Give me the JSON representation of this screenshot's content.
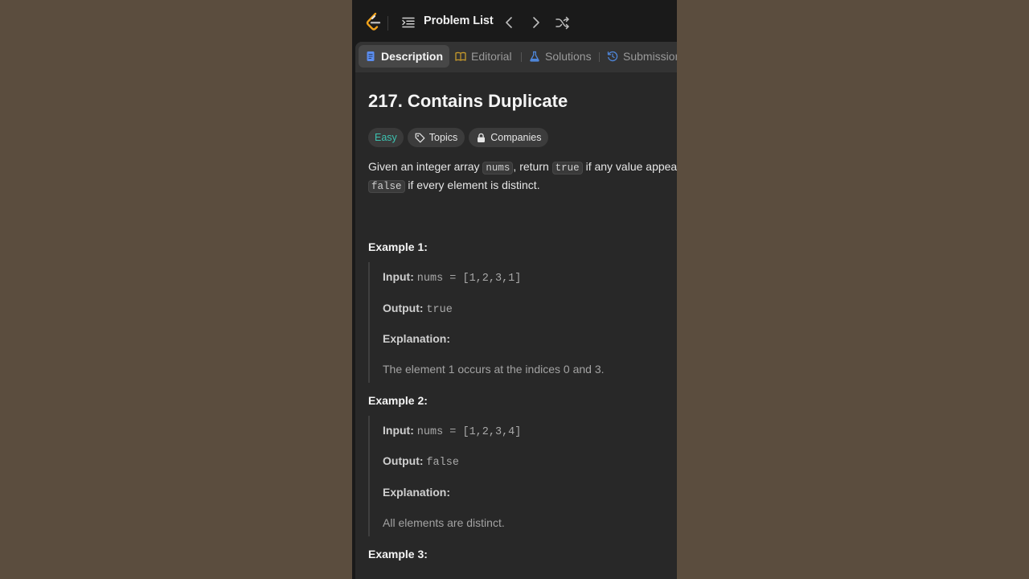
{
  "topbar": {
    "problem_list_label": "Problem List",
    "icons": [
      "leetcode-logo-icon",
      "list-icon",
      "chevron-left-icon",
      "chevron-right-icon",
      "shuffle-icon"
    ]
  },
  "tabs": [
    {
      "label": "Description",
      "icon": "description-icon",
      "active": true
    },
    {
      "label": "Editorial",
      "icon": "book-icon",
      "active": false
    },
    {
      "label": "Solutions",
      "icon": "flask-icon",
      "active": false
    },
    {
      "label": "Submissions",
      "icon": "history-icon",
      "active": false
    }
  ],
  "problem": {
    "title": "217. Contains Duplicate",
    "difficulty": "Easy",
    "topics_label": "Topics",
    "companies_label": "Companies",
    "desc_part1": "Given an integer array ",
    "desc_code1": "nums",
    "desc_part2": ", return ",
    "desc_code2": "true",
    "desc_part3": " if any value appears at least twice in the array, and return",
    "desc_code3": "false",
    "desc_part4": " if every element is distinct."
  },
  "examples": [
    {
      "title": "Example 1:",
      "input_label": "Input:",
      "input": "nums = [1,2,3,1]",
      "output_label": "Output:",
      "output": "true",
      "explanation_label": "Explanation:",
      "explanation": "The element 1 occurs at the indices 0 and 3."
    },
    {
      "title": "Example 2:",
      "input_label": "Input:",
      "input": "nums = [1,2,3,4]",
      "output_label": "Output:",
      "output": "false",
      "explanation_label": "Explanation:",
      "explanation": "All elements are distinct."
    },
    {
      "title": "Example 3:"
    }
  ],
  "colors": {
    "background": "#5b4d3e",
    "panel": "#282828",
    "easy": "#3cc2b0",
    "active_tab_icon": "#5b8def",
    "logo_orange": "#f0a21b"
  }
}
